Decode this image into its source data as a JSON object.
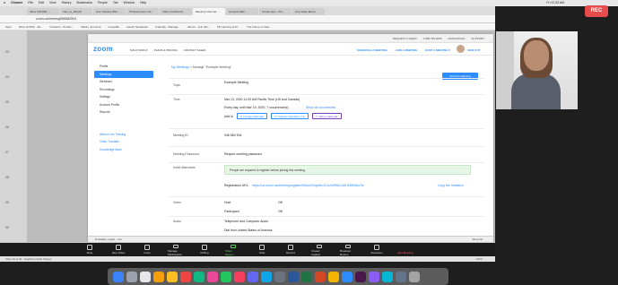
{
  "macos_menu": {
    "items": [
      "Chrome",
      "File",
      "Edit",
      "View",
      "History",
      "Bookmarks",
      "People",
      "Tab",
      "Window",
      "Help"
    ],
    "clock": "Fri 11:33 AM"
  },
  "tabs": [
    "Inbox (28,306) - ...",
    "Intro_to_ZR.pdf",
    "Live Training Web...",
    "76 Resources | Ze...",
    "Video Conferenci...",
    "Meeting Informati...",
    "Campus Mail - ...",
    "Create Item - Pre...",
    "Live Video Event..."
  ],
  "address": "zoom.us/meeting/846682504",
  "bookmarks": [
    "Apps",
    "Inbox (6,569) - dls...",
    "Incidents - Produc...",
    "Slack | Join Ezra",
    "GroupMe",
    "Feedl | Newsletter",
    "Calendly - Manage...",
    "Alumni - Join this...",
    "Mi Learning at M...",
    "The Future of Clas..."
  ],
  "zoom_header": {
    "links": [
      "REQUEST A DEMO",
      "1.888.799.9666",
      "RESOURCES",
      "SUPPORT"
    ]
  },
  "zoom_nav": {
    "logo": "zoom",
    "menu": [
      "SOLUTIONS ▾",
      "PLANS & PRICING",
      "CONTACT SALES"
    ],
    "right": [
      "SCHEDULE A MEETING",
      "JOIN A MEETING",
      "HOST A MEETING ▾"
    ],
    "signout": "SIGN OUT"
  },
  "sidebar": {
    "items": [
      "Profile",
      "Meetings",
      "Webinars",
      "Recordings",
      "Settings",
      "Account Profile",
      "Reports"
    ],
    "active": 1,
    "extra": [
      "Attend Live Training",
      "Video Tutorials",
      "Knowledge Base"
    ]
  },
  "breadcrumb": {
    "root": "My Meetings",
    "sep": ">",
    "current": "Manage \"Example Meeting\""
  },
  "start_button": "Start this Meeting",
  "details": {
    "topic_label": "Topic",
    "topic": "Example Meeting",
    "time_label": "Time",
    "time": "Mar 13, 2020 11:00 AM Pacific Time (US and Canada)",
    "recurrence": "Every day, until Mar 19, 2020, 7 occurrence(s)",
    "show_all": "Show all occurrences",
    "add_to": "Add to",
    "calendars": [
      "Google Calendar",
      "Outlook Calendar (.ics)",
      "Yahoo Calendar"
    ],
    "id_label": "Meeting ID",
    "id": "946 682 504",
    "pwd_label": "Meeting Password",
    "pwd": "Require meeting password",
    "invite_label": "Invite Attendees",
    "notice": "People are required to register before joining this meeting.",
    "reg_label": "Registration URL:",
    "reg_url": "https://us.zoom.us/meeting/register/tJAvceGrqzMuGZJc/mR5ACsDHZ8HMdoTw",
    "copy": "Copy the invitation",
    "video_label": "Video",
    "host": "Host",
    "host_val": "Off",
    "participant": "Participant",
    "part_val": "Off",
    "audio_label": "Audio",
    "audio": "Telephone and Computer Audio",
    "dial": "Dial from United States of America"
  },
  "download_bar": {
    "file": "limitadaor_regist....csv",
    "show_all": "Show All"
  },
  "notes": "Click to add notes",
  "status": {
    "slide": "Slide 26 of 30",
    "lang": "English (United States)",
    "zoom": "134%"
  },
  "zoom_toolbar": [
    "Mute",
    "Stop Video",
    "Invite",
    "Manage Participants",
    "Polling",
    "Share Screen",
    "Chat",
    "Record",
    "Closed Caption",
    "Breakout Rooms",
    "Reactions",
    "End Meeting"
  ],
  "slide_numbers": [
    "23",
    "24",
    "25",
    "26",
    "27",
    "28",
    "29",
    "30"
  ],
  "rec": "REC",
  "colors": {
    "accent": "#2d8cff",
    "rec": "#e84c4c"
  }
}
